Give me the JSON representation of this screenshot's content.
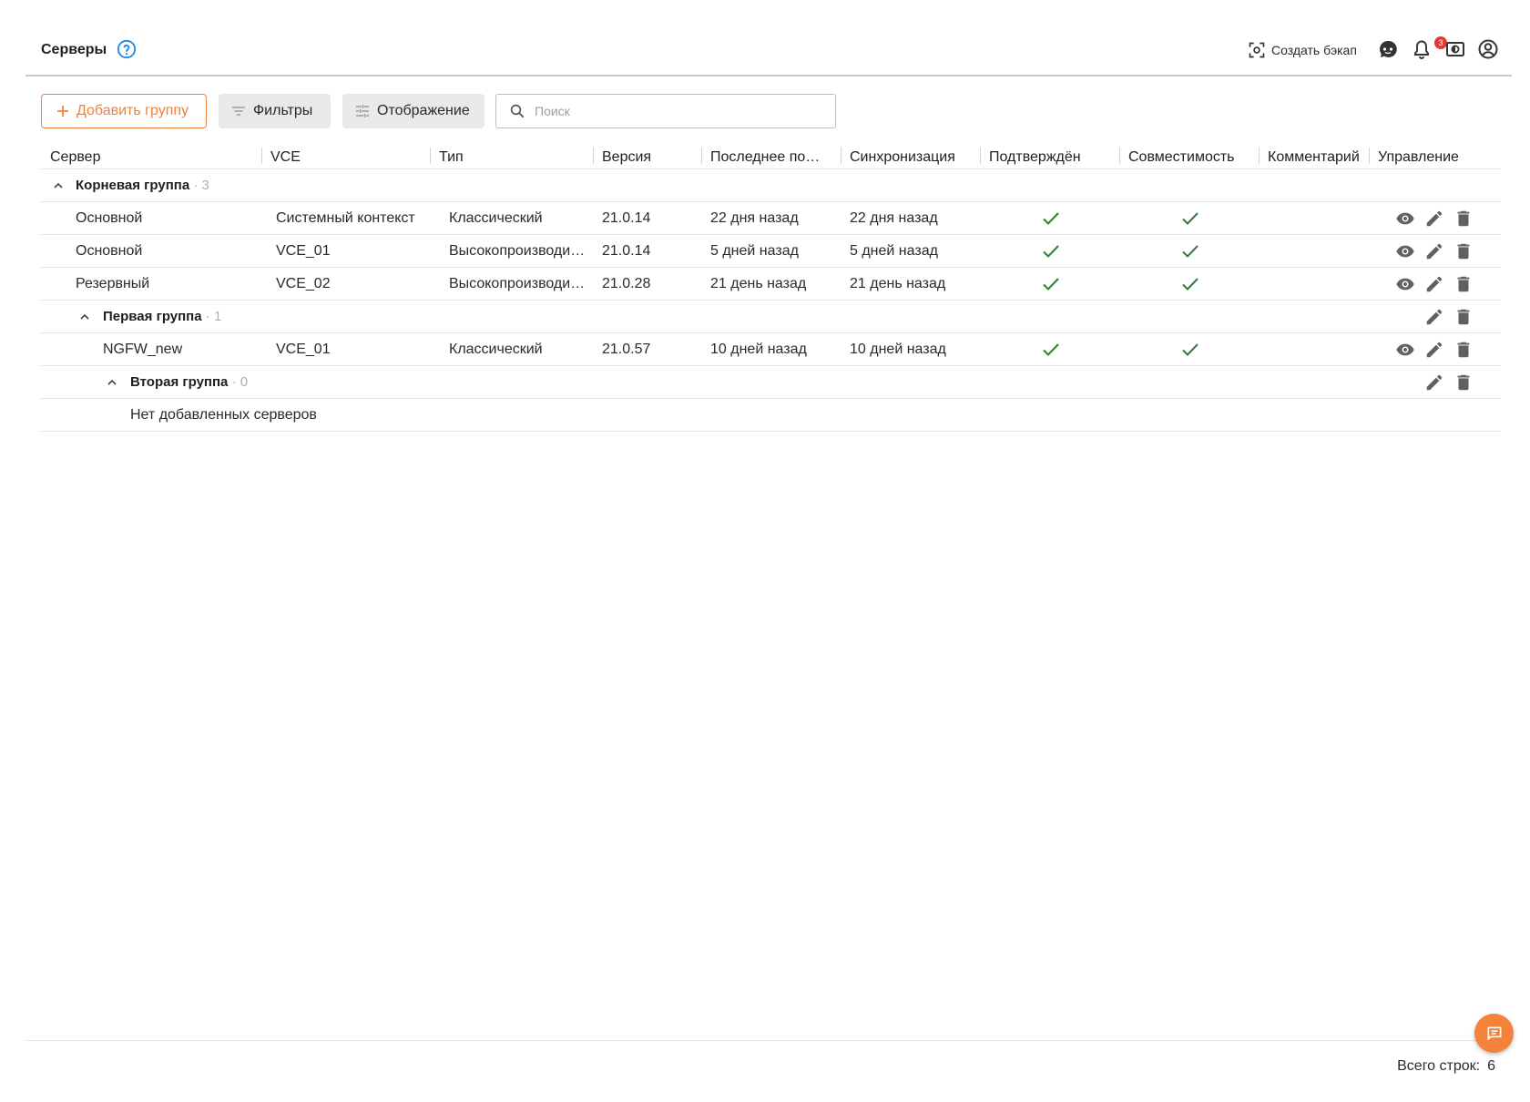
{
  "header": {
    "title": "Серверы",
    "backup_label": "Создать бэкап",
    "notifications_count": "3",
    "icons": [
      "help-icon",
      "screenshot-icon",
      "assistant-icon",
      "bell-icon",
      "display-icon",
      "account-icon"
    ]
  },
  "toolbar": {
    "add_group_label": "Добавить группу",
    "filters_label": "Фильтры",
    "display_label": "Отображение",
    "search_placeholder": "Поиск"
  },
  "columns": [
    "Сервер",
    "VCE",
    "Тип",
    "Версия",
    "Последнее по…",
    "Синхронизация",
    "Подтверждён",
    "Совместимость",
    "Комментарий",
    "Управление"
  ],
  "groups": [
    {
      "name": "Корневая группа",
      "count": "3",
      "rows": [
        {
          "server": "Основной",
          "vce": "Системный контекст",
          "type": "Классический",
          "version": "21.0.14",
          "last": "22 дня назад",
          "sync": "22 дня назад",
          "confirmed": true,
          "compatible": true,
          "comment": ""
        },
        {
          "server": "Основной",
          "vce": "VCE_01",
          "type": "Высокопроизводи…",
          "version": "21.0.14",
          "last": "5 дней назад",
          "sync": "5 дней назад",
          "confirmed": true,
          "compatible": true,
          "comment": ""
        },
        {
          "server": "Резервный",
          "vce": "VCE_02",
          "type": "Высокопроизводи…",
          "version": "21.0.28",
          "last": "21 день назад",
          "sync": "21 день назад",
          "confirmed": true,
          "compatible": true,
          "comment": ""
        }
      ]
    },
    {
      "name": "Первая группа",
      "count": "1",
      "rows": [
        {
          "server": "NGFW_new",
          "vce": "VCE_01",
          "type": "Классический",
          "version": "21.0.57",
          "last": "10 дней назад",
          "sync": "10 дней назад",
          "confirmed": true,
          "compatible": true,
          "comment": ""
        }
      ]
    },
    {
      "name": "Вторая группа",
      "count": "0",
      "empty_text": "Нет добавленных серверов"
    }
  ],
  "footer": {
    "total_label": "Всего строк:",
    "total_value": "6"
  },
  "colors": {
    "accent": "#f0823c",
    "check": "#2e7d32",
    "badge": "#e53935"
  }
}
